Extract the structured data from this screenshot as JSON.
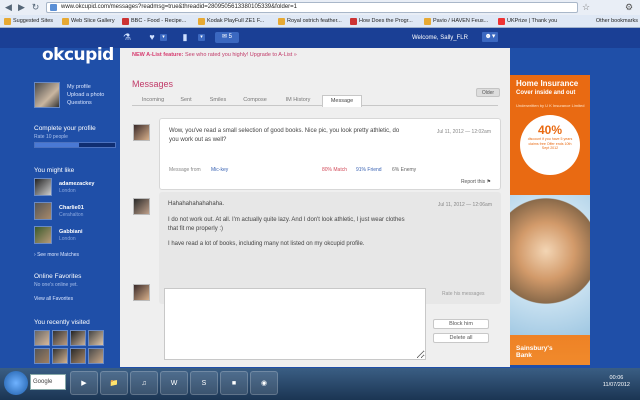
{
  "browser": {
    "url": "www.okcupid.com/messages?readmsg=true&threadid=2809505613380105339&folder=1",
    "bookmarks": [
      "Suggested Sites",
      "Web Slice Gallery",
      "BBC - Food - Recipe...",
      "Kodak PlayFull ZE1 F...",
      "Royal ostrich feather...",
      "How Does the Progr...",
      "Pavio / HAVEN Feus...",
      "UKPrize | Thank you"
    ],
    "other_bookmarks": "Other bookmarks"
  },
  "header": {
    "logo": "okcupid",
    "welcome": "Welcome, Sally_FLR",
    "mail_count": "5"
  },
  "sidebar": {
    "my_profile": "My profile",
    "upload_photo": "Upload a photo",
    "questions": "Questions",
    "complete_title": "Complete your profile",
    "complete_sub": "Rate 10 people",
    "progress": 0.55,
    "you_might_like": "You might like",
    "matches": [
      {
        "name": "adamezackey",
        "loc": "London"
      },
      {
        "name": "Charlie01",
        "loc": "Cerahalton"
      },
      {
        "name": "Gabbiani",
        "loc": "London"
      }
    ],
    "see_more": "See more Matches",
    "online_title": "Online Favorites",
    "online_sub": "No one's online yet.",
    "view_all": "View all Favorites",
    "visited_title": "You recently visited"
  },
  "main": {
    "notice_label": "NEW A-List feature:",
    "notice_text": "See who rated you highly! Upgrade to A-List »",
    "title": "Messages",
    "older": "Older",
    "tabs": [
      "Incoming",
      "Sent",
      "Smiles",
      "Compose",
      "IM History",
      "Message"
    ],
    "message1": {
      "text": "Wow, you've read a small selection of good books. Nice pic, you look pretty athletic, do you work out as well?",
      "date": "Jul 11, 2012 — 12:02am",
      "from_label": "Message from",
      "from": "Mic-key",
      "match": "80% Match",
      "friend": "91% Friend",
      "enemy": "6% Enemy",
      "report": "Report this"
    },
    "message2": {
      "line1": "Hahahahahahahaha.",
      "line2": "I do not work out. At all. I'm actually quite lazy. And I don't look athletic, I just wear clothes that fit me properly :)",
      "line3": "I have read a lot of books, including many not listed on my okcupid profile.",
      "date": "Jul 11, 2012 — 12:06am"
    },
    "rate_label": "Rate his messages",
    "block": "Block him",
    "delete": "Delete all"
  },
  "ad": {
    "title": "Home Insurance",
    "subtitle": "Cover inside and out",
    "small": "Underwritten by U K Insurance Limited",
    "pct": "40%",
    "pct_text": "discount if you have 5 years claims free Offer ends 10th Sept 2012",
    "brand1": "Sainsbury's",
    "brand2": "Bank"
  },
  "taskbar": {
    "google": "Google",
    "time": "00:06",
    "date": "11/07/2012"
  }
}
